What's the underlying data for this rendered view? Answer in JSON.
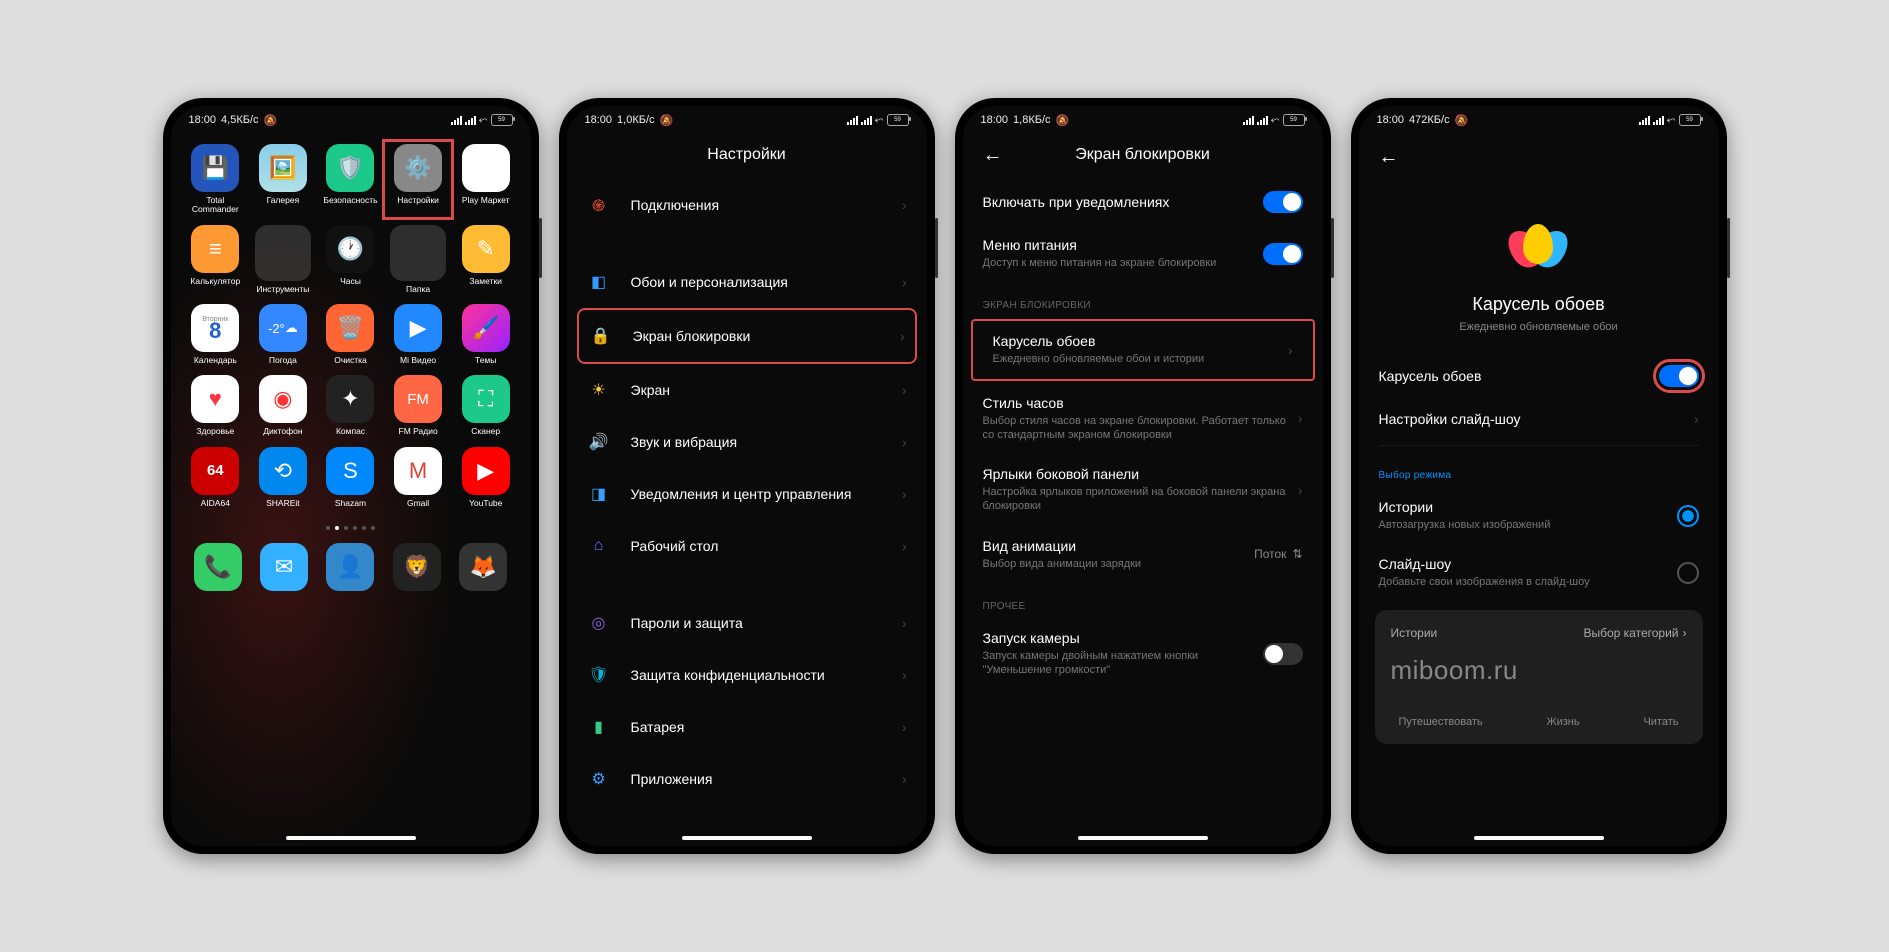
{
  "status": {
    "time": "18:00",
    "speed1": "4,5КБ/с",
    "speed2": "1,0КБ/с",
    "speed3": "1,8КБ/с",
    "speed4": "472КБ/с",
    "batt": "59"
  },
  "s1": {
    "apps": [
      {
        "label": "Total Commander"
      },
      {
        "label": "Галерея"
      },
      {
        "label": "Безопасность"
      },
      {
        "label": "Настройки"
      },
      {
        "label": "Play Маркет"
      },
      {
        "label": "Калькулятор"
      },
      {
        "label": "Инструменты"
      },
      {
        "label": "Часы"
      },
      {
        "label": "Папка"
      },
      {
        "label": "Заметки"
      },
      {
        "label": "Календарь",
        "sub": "8",
        "day": "Вторник"
      },
      {
        "label": "Погода",
        "sub": "-2°"
      },
      {
        "label": "Очистка"
      },
      {
        "label": "Mi Видео"
      },
      {
        "label": "Темы"
      },
      {
        "label": "Здоровье"
      },
      {
        "label": "Диктофон"
      },
      {
        "label": "Компас"
      },
      {
        "label": "FM Радио"
      },
      {
        "label": "Сканер"
      },
      {
        "label": "AIDA64"
      },
      {
        "label": "SHAREit"
      },
      {
        "label": "Shazam"
      },
      {
        "label": "Gmail"
      },
      {
        "label": "YouTube"
      }
    ]
  },
  "s2": {
    "title": "Настройки",
    "rows": [
      {
        "label": "Подключения",
        "icon": "knot",
        "color": "#ff5533"
      },
      {
        "label": "Обои и персонализация",
        "icon": "brush",
        "color": "#339aff"
      },
      {
        "label": "Экран блокировки",
        "icon": "lock",
        "color": "#ff4040",
        "hl": true
      },
      {
        "label": "Экран",
        "icon": "sun",
        "color": "#ffcc33"
      },
      {
        "label": "Звук и вибрация",
        "icon": "sound",
        "color": "#44cc66"
      },
      {
        "label": "Уведомления и центр управления",
        "icon": "bell",
        "color": "#33a0ff"
      },
      {
        "label": "Рабочий стол",
        "icon": "home",
        "color": "#6677ff"
      },
      {
        "label": "Пароли и защита",
        "icon": "finger",
        "color": "#8866dd"
      },
      {
        "label": "Защита конфиденциальности",
        "icon": "shield",
        "color": "#00bbdd"
      },
      {
        "label": "Батарея",
        "icon": "batt",
        "color": "#33cc88"
      },
      {
        "label": "Приложения",
        "icon": "apps",
        "color": "#33a0ff"
      }
    ]
  },
  "s3": {
    "title": "Экран блокировки",
    "top": {
      "t1": "Включать при уведомлениях",
      "t2": "Меню питания",
      "s2": "Доступ к меню питания на экране блокировки"
    },
    "sec": "ЭКРАН БЛОКИРОВКИ",
    "carousel": {
      "title": "Карусель обоев",
      "sub": "Ежедневно обновляемые обои и истории"
    },
    "clock": {
      "title": "Стиль часов",
      "sub": "Выбор стиля часов на экране блокировки. Работает только со стандартным экраном блокировки"
    },
    "short": {
      "title": "Ярлыки боковой панели",
      "sub": "Настройка ярлыков приложений на боковой панели экрана блокировки"
    },
    "anim": {
      "title": "Вид анимации",
      "sub": "Выбор вида анимации зарядки",
      "val": "Поток"
    },
    "sec2": "ПРОЧЕЕ",
    "cam": {
      "title": "Запуск камеры",
      "sub": "Запуск камеры двойным нажатием кнопки \"Уменьшение громкости\""
    }
  },
  "s4": {
    "hero": {
      "title": "Карусель обоев",
      "sub": "Ежедневно обновляемые обои"
    },
    "toggle": {
      "label": "Карусель обоев"
    },
    "slide": {
      "label": "Настройки слайд-шоу"
    },
    "mode": "Выбор режима",
    "m1": {
      "title": "Истории",
      "sub": "Автозагрузка новых изображений"
    },
    "m2": {
      "title": "Слайд-шоу",
      "sub": "Добавьте свои изображения в слайд-шоу"
    },
    "hist": {
      "title": "Истории",
      "cat": "Выбор категорий",
      "big": "miboom.ru",
      "c1": "Путешествовать",
      "c2": "Жизнь",
      "c3": "Читать"
    }
  }
}
